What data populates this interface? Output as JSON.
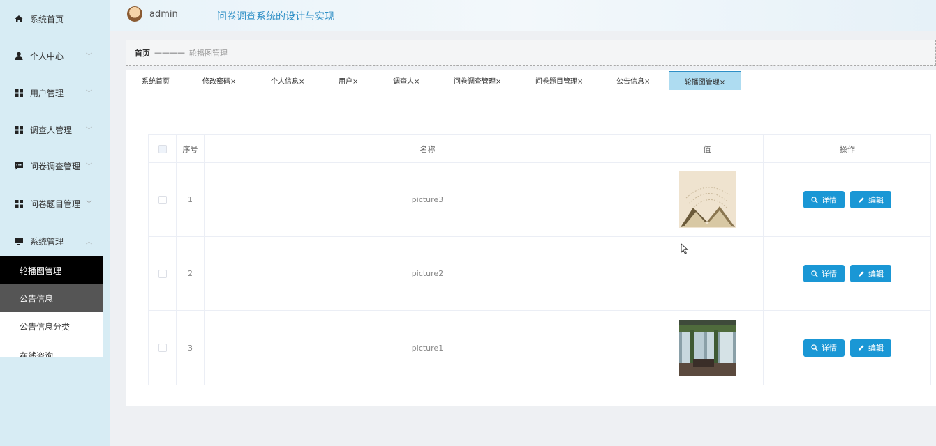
{
  "header": {
    "user": "admin",
    "title": "问卷调查系统的设计与实现"
  },
  "sidebar": {
    "items": [
      {
        "label": "系统首页",
        "icon": "home-icon"
      },
      {
        "label": "个人中心",
        "icon": "user-icon"
      },
      {
        "label": "用户管理",
        "icon": "grid-icon"
      },
      {
        "label": "调查人管理",
        "icon": "grid-icon"
      },
      {
        "label": "问卷调查管理",
        "icon": "chat-icon"
      },
      {
        "label": "问卷题目管理",
        "icon": "grid-icon"
      },
      {
        "label": "系统管理",
        "icon": "monitor-icon"
      }
    ],
    "subitems": [
      "轮播图管理",
      "公告信息",
      "公告信息分类",
      "在线咨询"
    ]
  },
  "breadcrumb": {
    "home": "首页",
    "separator": "————",
    "current": "轮播图管理"
  },
  "tabs": [
    "系统首页",
    "修改密码×",
    "个人信息×",
    "用户×",
    "调查人×",
    "问卷调查管理×",
    "问卷题目管理×",
    "公告信息×",
    "轮播图管理×"
  ],
  "table": {
    "headers": {
      "index": "序号",
      "name": "名称",
      "value": "值",
      "ops": "操作"
    },
    "rows": [
      {
        "index": "1",
        "name": "picture3",
        "image": "book-image"
      },
      {
        "index": "2",
        "name": "picture2",
        "image": ""
      },
      {
        "index": "3",
        "name": "picture1",
        "image": "interior-image"
      }
    ],
    "detail_label": "详情",
    "edit_label": "编辑"
  },
  "colors": {
    "accent": "#1a97d5",
    "sidebar": "#d7ecf4",
    "title": "#2e8fc6"
  }
}
